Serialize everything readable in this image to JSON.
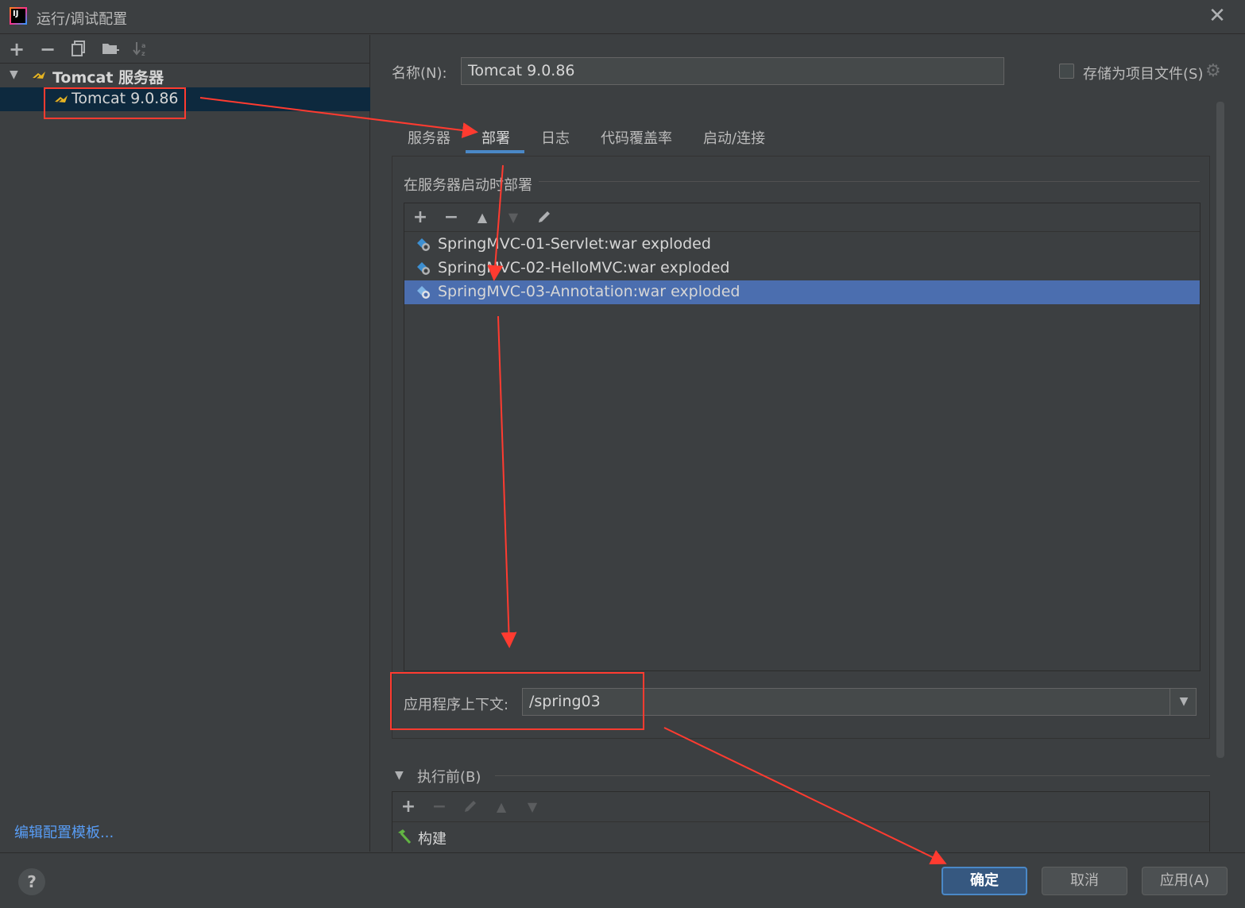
{
  "window": {
    "title": "运行/调试配置",
    "close_glyph": "✕"
  },
  "left_panel": {
    "toolbar": {
      "add": "+",
      "remove": "−",
      "copy_icon": "copy-icon",
      "folder_icon": "new-folder-icon",
      "sort_icon": "sort-icon"
    },
    "tree": {
      "group_label": "Tomcat 服务器",
      "item_label": "Tomcat 9.0.86"
    },
    "edit_templates_link": "编辑配置模板..."
  },
  "right_panel": {
    "name_label": "名称(N):",
    "name_value": "Tomcat 9.0.86",
    "store_label": "存储为项目文件(S)",
    "store_checked": false,
    "tabs": [
      "服务器",
      "部署",
      "日志",
      "代码覆盖率",
      "启动/连接"
    ],
    "active_tab": "部署",
    "deploy_section_title": "在服务器启动时部署",
    "artifacts": [
      "SpringMVC-01-Servlet:war exploded",
      "SpringMVC-02-HelloMVC:war exploded",
      "SpringMVC-03-Annotation:war exploded"
    ],
    "selected_artifact_index": 2,
    "context_label": "应用程序上下文:",
    "context_value": "/spring03",
    "before_launch_label": "执行前(B)",
    "before_launch_tasks": [
      "构建"
    ]
  },
  "footer": {
    "help": "?",
    "ok": "确定",
    "cancel": "取消",
    "apply": "应用(A)"
  },
  "colors": {
    "background": "#3c3f41",
    "selection": "#4b6eaf",
    "tree_selection": "#0d293e",
    "accent": "#4a88c7",
    "link": "#589df6",
    "annotation": "#ff3b30"
  }
}
